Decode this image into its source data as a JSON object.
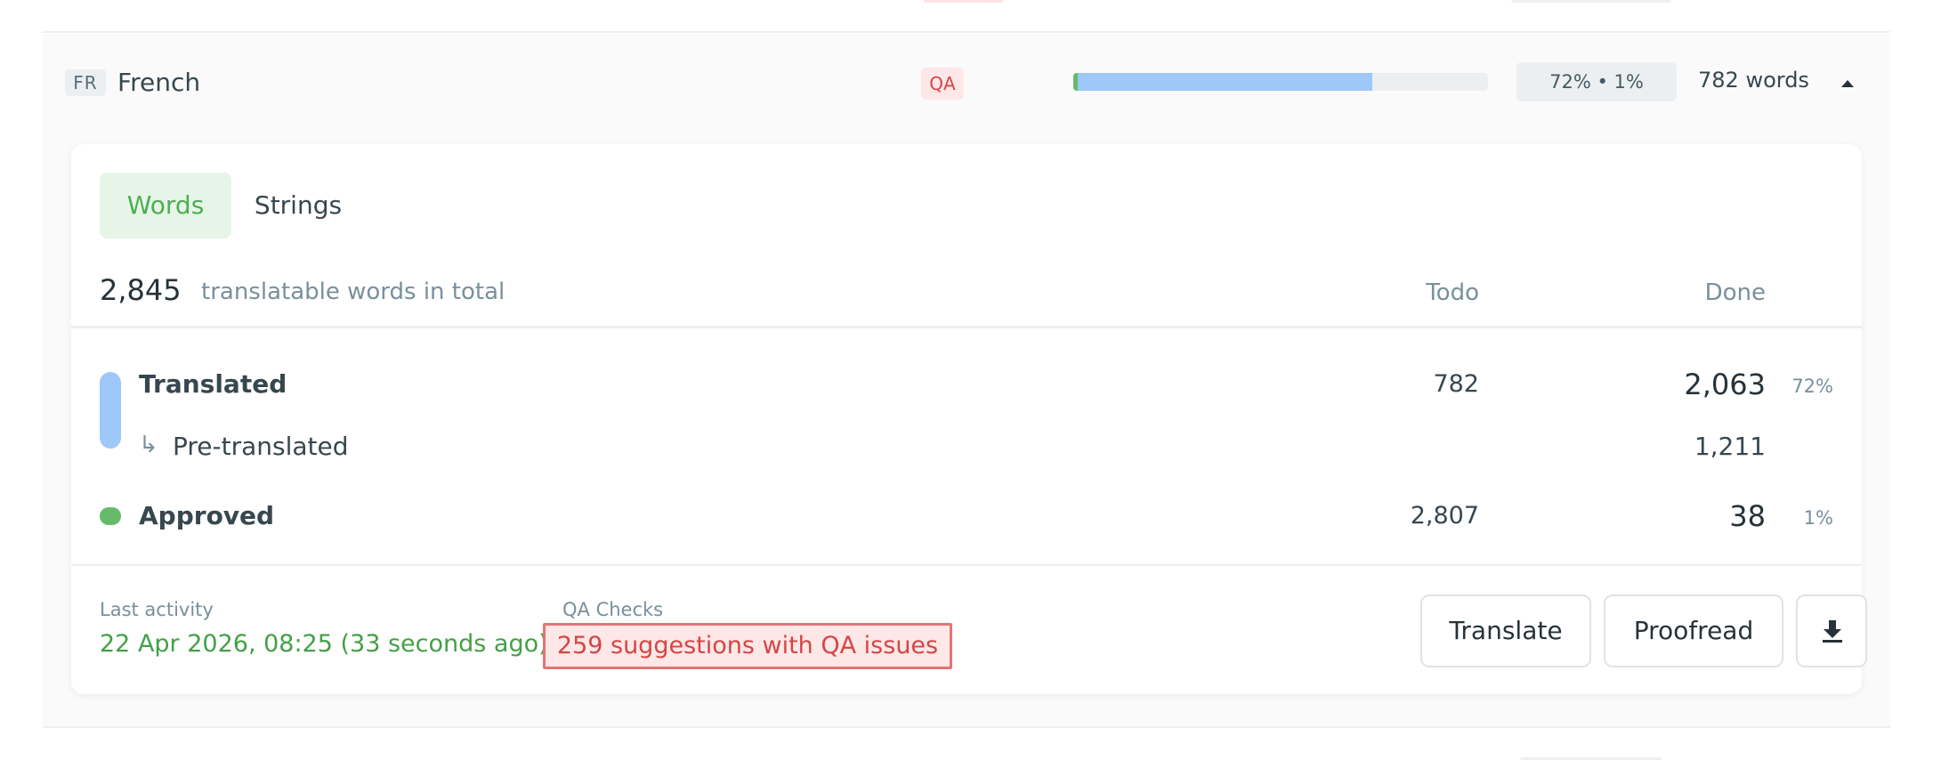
{
  "language": {
    "code": "FR",
    "name": "French",
    "qa_badge": "QA",
    "progress": {
      "translated_percent": 72,
      "approved_percent": 1
    },
    "percent_label": "72% • 1%",
    "words_label": "782 words",
    "collapse_icon": "chevron-up-icon"
  },
  "tabs": [
    {
      "label": "Words",
      "active": true
    },
    {
      "label": "Strings",
      "active": false
    }
  ],
  "summary": {
    "total": "2,845",
    "total_label": "translatable words in total",
    "col_todo": "Todo",
    "col_done": "Done"
  },
  "rows": {
    "translated": {
      "label": "Translated",
      "todo": "782",
      "done": "2,063",
      "pct": "72%",
      "color": "#9ec8f8"
    },
    "pretranslated": {
      "arrow": "↳",
      "label": "Pre-translated",
      "done": "1,211"
    },
    "approved": {
      "label": "Approved",
      "todo": "2,807",
      "done": "38",
      "pct": "1%",
      "color": "#66bb6a"
    }
  },
  "footer": {
    "last_activity_label": "Last activity",
    "last_activity_value": "22 Apr 2026, 08:25 (33 seconds ago)",
    "qa_label": "QA Checks",
    "qa_value": "259 suggestions with QA issues",
    "translate_button": "Translate",
    "proofread_button": "Proofread",
    "download_icon": "download-icon"
  },
  "colors": {
    "accent_green": "#4caf50",
    "qa_red": "#d64545",
    "translated_blue": "#9ec8f8",
    "approved_green": "#66bb6a"
  }
}
